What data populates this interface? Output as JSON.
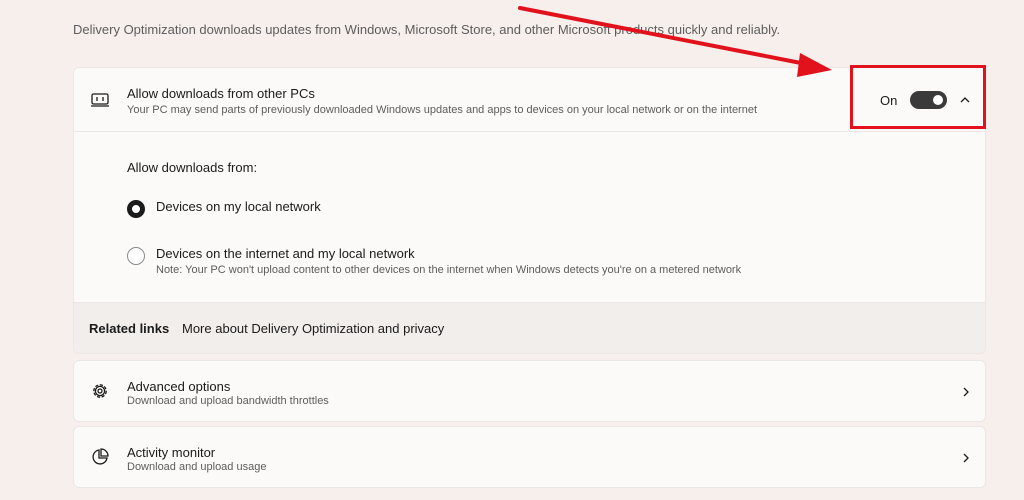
{
  "intro_text": "Delivery Optimization downloads updates from Windows, Microsoft Store, and other Microsoft products quickly and reliably.",
  "main_setting": {
    "icon": "laptop-download-icon",
    "title": "Allow downloads from other PCs",
    "subtitle": "Your PC may send parts of previously downloaded Windows updates and apps to devices on your local network or on the internet",
    "toggle_label": "On",
    "toggle_on": true
  },
  "expanded": {
    "label": "Allow downloads from:",
    "options": [
      {
        "label": "Devices on my local network",
        "selected": true
      },
      {
        "label": "Devices on the internet and my local network",
        "note": "Note: Your PC won't upload content to other devices on the internet when Windows detects you're on a metered network",
        "selected": false
      }
    ]
  },
  "related_links": {
    "title": "Related links",
    "link": "More about Delivery Optimization and privacy"
  },
  "cards": [
    {
      "icon": "gear-icon",
      "title": "Advanced options",
      "subtitle": "Download and upload bandwidth throttles"
    },
    {
      "icon": "pie-chart-icon",
      "title": "Activity monitor",
      "subtitle": "Download and upload usage"
    }
  ],
  "colors": {
    "background": "#f7efeb",
    "card": "#fbfaf9",
    "annotation_red": "#e1121b",
    "toggle_on": "#3a3a3a"
  }
}
